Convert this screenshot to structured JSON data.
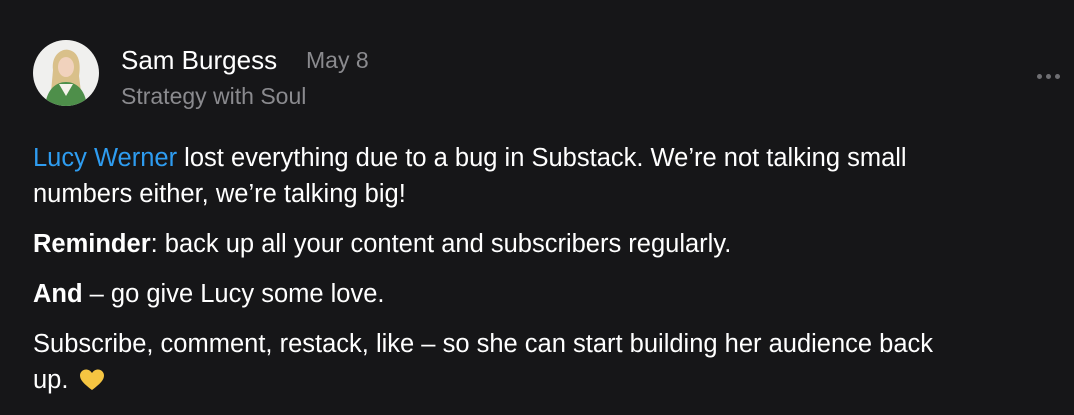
{
  "author": {
    "name": "Sam Burgess",
    "date": "May 8",
    "publication": "Strategy with Soul"
  },
  "menu": {
    "icon": "more-horizontal-icon"
  },
  "body": {
    "p1": {
      "mention": "Lucy Werner",
      "line1_rest": " lost everything due to a bug in Substack. We’re not talking small",
      "line2": "numbers either, we’re talking big!"
    },
    "p2": {
      "bold": "Reminder",
      "rest": ": back up all your content and subscribers regularly."
    },
    "p3": {
      "bold": "And",
      "rest": " – go give Lucy some love."
    },
    "p4": {
      "line1": "Subscribe, comment, restack, like – so she can start building her audience back",
      "line2": "up."
    },
    "emoji": "yellow-heart-icon"
  },
  "colors": {
    "background": "#161618",
    "text": "#ffffff",
    "muted": "#8a8a8e",
    "link": "#2e9cf0",
    "heart": "#f5c542"
  }
}
